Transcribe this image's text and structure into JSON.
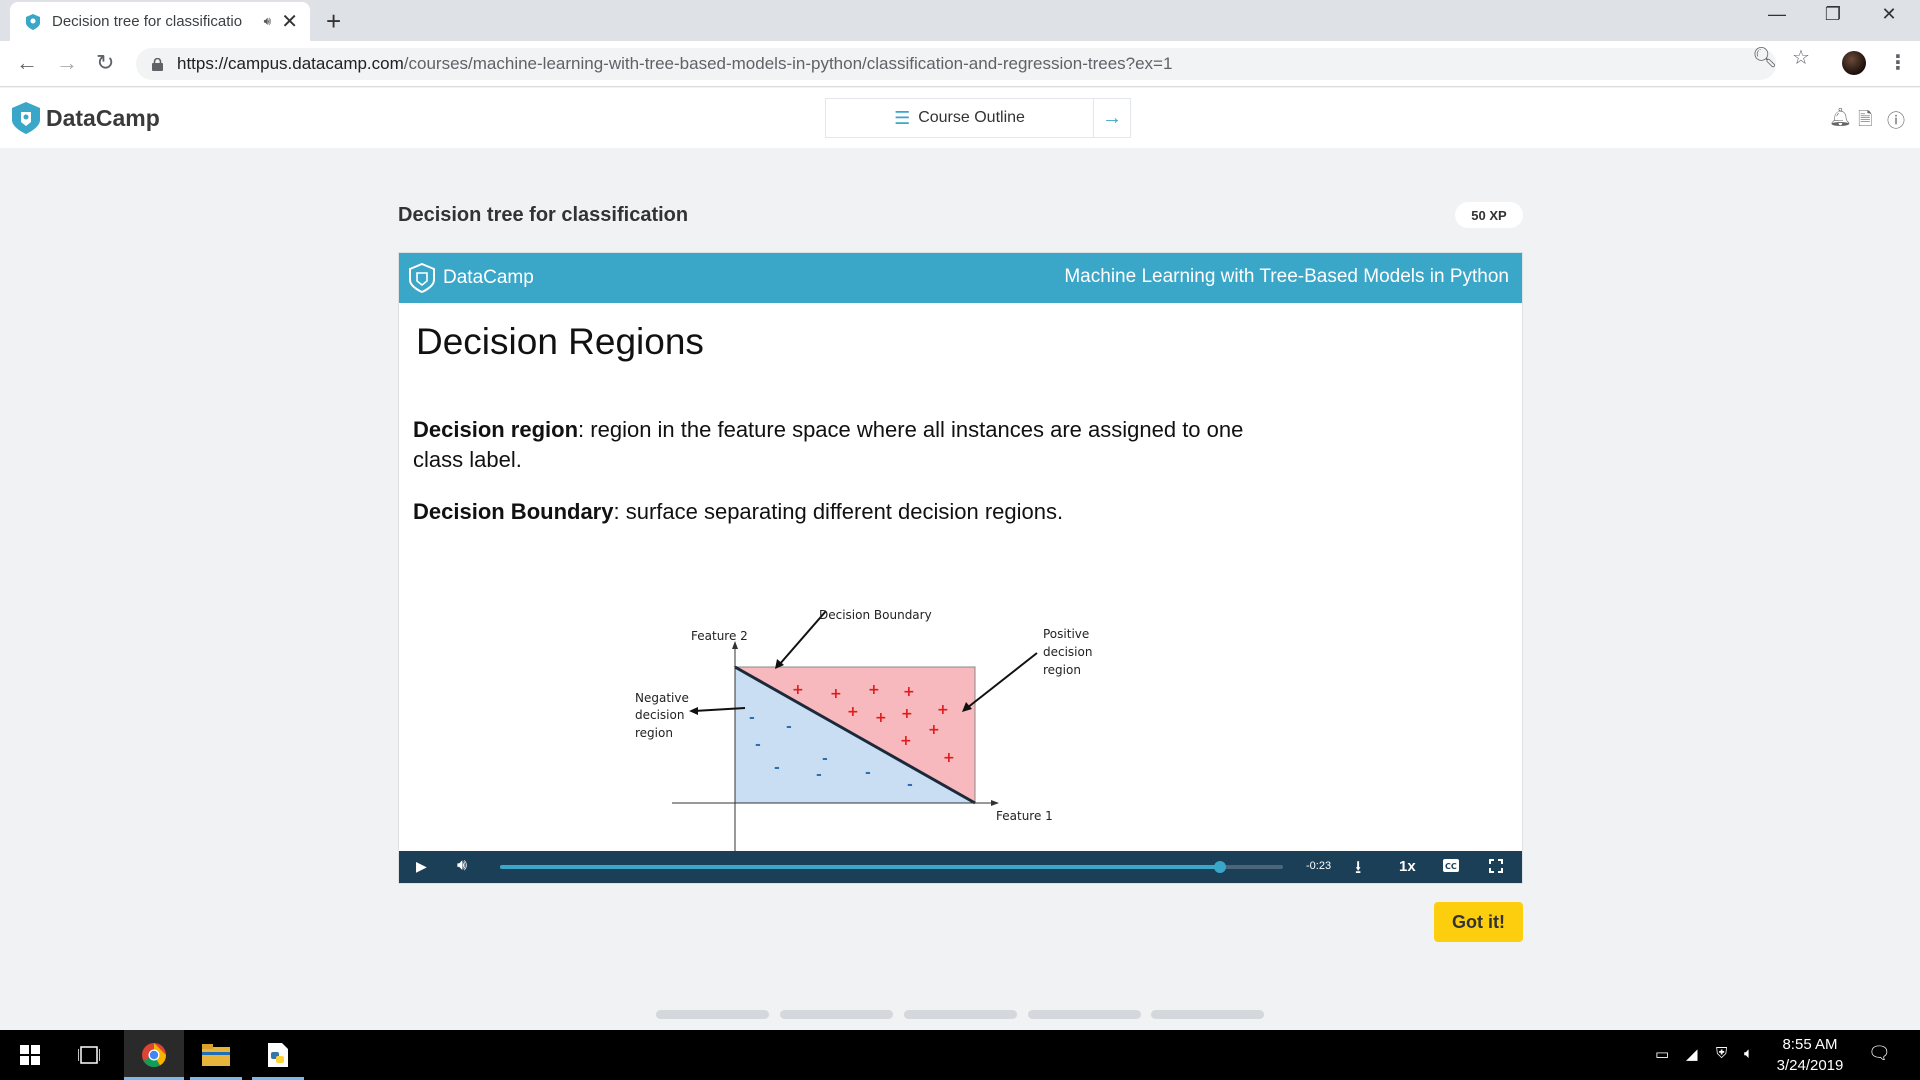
{
  "browser": {
    "tab_title": "Decision tree for classificatio",
    "new_tab": "+",
    "url_host": "https://campus.datacamp.com",
    "url_path": "/courses/machine-learning-with-tree-based-models-in-python/classification-and-regression-trees?ex=1",
    "window_controls": [
      "minimize-icon",
      "restore-icon",
      "close-icon"
    ]
  },
  "header": {
    "brand": "DataCamp",
    "course_outline": "Course Outline",
    "icons": [
      "bell-icon",
      "pdf-icon",
      "info-icon"
    ]
  },
  "exercise": {
    "title": "Decision tree for classification",
    "xp": "50 XP",
    "got_it": "Got it!"
  },
  "slide": {
    "brand": "DataCamp",
    "course": "Machine Learning with Tree-Based Models in Python",
    "heading": "Decision Regions",
    "p1_term": "Decision region",
    "p1_text": ": region in the feature space where all instances are assigned to one class label.",
    "p2_term": "Decision Boundary",
    "p2_text": ": surface separating different decision regions."
  },
  "diagram": {
    "label_boundary": "Decision Boundary",
    "label_feature2": "Feature 2",
    "label_feature1": "Feature 1",
    "label_negative": [
      "Negative",
      "decision",
      "region"
    ],
    "label_positive": [
      "Positive",
      "decision",
      "region"
    ],
    "colors": {
      "positive": "#f8b9be",
      "negative": "#c9def2",
      "plus": "#e11a1a",
      "minus": "#2f6fb0"
    }
  },
  "player": {
    "time_remaining": "-0:23",
    "speed": "1x",
    "progress": 0.92
  },
  "taskbar": {
    "time": "8:55 AM",
    "date": "3/24/2019"
  }
}
